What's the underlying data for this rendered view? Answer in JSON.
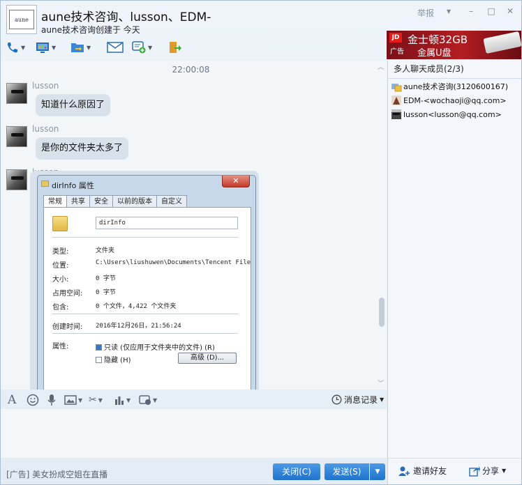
{
  "window": {
    "title": "aune技术咨询、lusson、EDM-",
    "subtitle": "aune技术咨询创建于 今天",
    "report_label": "举报",
    "avatar_text": "aune"
  },
  "ad_banner": {
    "brand": "JD",
    "tag": "广告",
    "line1": "金士顿32GB",
    "line2": "金属U盘"
  },
  "chat": {
    "timestamp": "22:00:08",
    "messages": [
      {
        "sender": "lusson",
        "text": "知道什么原因了"
      },
      {
        "sender": "lusson",
        "text": "是你的文件夹太多了"
      },
      {
        "sender": "lusson"
      }
    ]
  },
  "dialog": {
    "title": "dirInfo 属性",
    "tabs": [
      "常规",
      "共享",
      "安全",
      "以前的版本",
      "自定义"
    ],
    "name": "dirInfo",
    "rows": [
      {
        "k": "类型:",
        "v": "文件夹"
      },
      {
        "k": "位置:",
        "v": "C:\\Users\\liushuwen\\Documents\\Tencent File"
      },
      {
        "k": "大小:",
        "v": "0 字节"
      },
      {
        "k": "占用空间:",
        "v": "0 字节"
      },
      {
        "k": "包含:",
        "v": "0 个文件，4,422 个文件夹"
      },
      {
        "k": "创建时间:",
        "v": "2016年12月26日，21:56:24"
      }
    ],
    "attr_label": "属性:",
    "readonly": "只读 (仅应用于文件夹中的文件) (R)",
    "hidden": "隐藏 (H)",
    "advanced": "高级 (D)..."
  },
  "history_label": "消息记录",
  "bottom": {
    "ad_text": "[广告] 美女扮成空姐在直播",
    "close_label": "关闭(C)",
    "send_label": "发送(S)"
  },
  "sidebar": {
    "header": "多人聊天成员(2/3)",
    "members": [
      "aune技术咨询(3120600167)",
      "EDM-<wochaoji@qq.com>",
      "lusson<lusson@qq.com>"
    ],
    "invite_label": "邀请好友",
    "share_label": "分享"
  },
  "colors": {
    "accent": "#1f73cc",
    "ad_red": "#b31e22"
  }
}
